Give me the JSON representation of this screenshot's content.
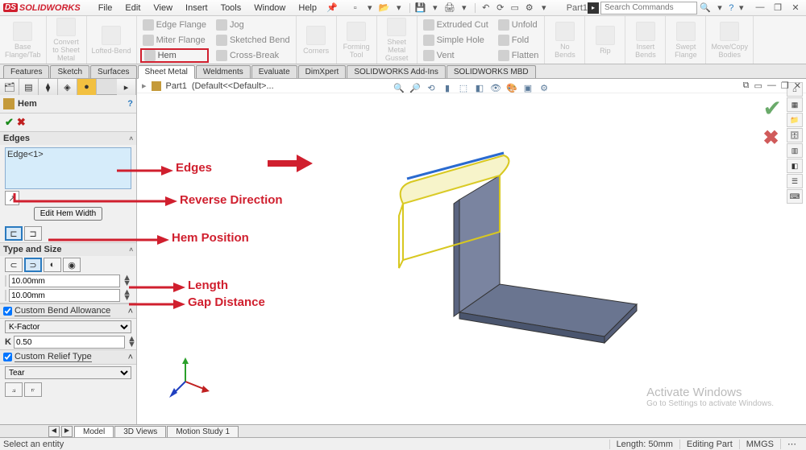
{
  "app_name": "SOLIDWORKS",
  "menu": {
    "file": "File",
    "edit": "Edit",
    "view": "View",
    "insert": "Insert",
    "tools": "Tools",
    "window": "Window",
    "help": "Help"
  },
  "doc_title": "Part1",
  "search_placeholder": "Search Commands",
  "ribbon": {
    "base_flange": "Base\nFlange/Tab",
    "convert": "Convert\nto Sheet\nMetal",
    "lofted": "Lofted-Bend",
    "edge_flange": "Edge Flange",
    "jog": "Jog",
    "miter": "Miter Flange",
    "sketched": "Sketched Bend",
    "hem": "Hem",
    "cross": "Cross-Break",
    "corners": "Corners",
    "forming": "Forming\nTool",
    "gusset": "Sheet\nMetal\nGusset",
    "extruded": "Extruded Cut",
    "simple": "Simple Hole",
    "vent": "Vent",
    "unfold": "Unfold",
    "fold": "Fold",
    "flatten": "Flatten",
    "no_bends": "No\nBends",
    "rip": "Rip",
    "insert_bends": "Insert\nBends",
    "swept": "Swept\nFlange",
    "movecopy": "Move/Copy\nBodies"
  },
  "tabs": {
    "features": "Features",
    "sketch": "Sketch",
    "surfaces": "Surfaces",
    "sheetmetal": "Sheet Metal",
    "weldments": "Weldments",
    "evaluate": "Evaluate",
    "dimxpert": "DimXpert",
    "addins": "SOLIDWORKS Add-Ins",
    "mbd": "SOLIDWORKS MBD"
  },
  "breadcrumb": {
    "part": "Part1",
    "config": "(Default<<Default>..."
  },
  "pm": {
    "title": "Hem",
    "edges_h": "Edges",
    "edge_item": "Edge<1>",
    "edit_hem": "Edit Hem Width",
    "type_size": "Type and Size",
    "length": "10.00mm",
    "gap": "10.00mm",
    "cba": "Custom Bend Allowance",
    "kfactor_opt": "K-Factor",
    "k_label": "K",
    "k_val": "0.50",
    "crt": "Custom Relief Type",
    "tear_opt": "Tear"
  },
  "anno": {
    "edges": "Edges",
    "reverse": "Reverse Direction",
    "hem_pos": "Hem Position",
    "length": "Length",
    "gap": "Gap Distance"
  },
  "btm": {
    "model": "Model",
    "views": "3D Views",
    "motion": "Motion Study 1"
  },
  "status": {
    "hint": "Select an entity",
    "length": "Length: 50mm",
    "mode": "Editing Part",
    "units": "MMGS"
  },
  "activate": {
    "t1": "Activate Windows",
    "t2": "Go to Settings to activate Windows."
  }
}
